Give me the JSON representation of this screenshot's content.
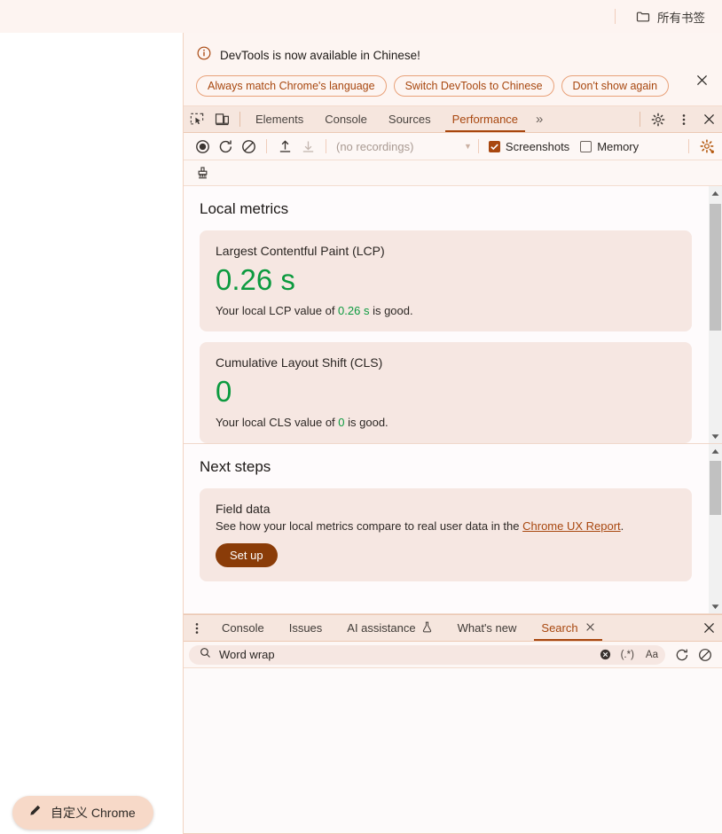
{
  "browser": {
    "bookmarks_button": {
      "label": "所有书签",
      "icon": "folder-icon"
    },
    "customize_chrome": {
      "label": "自定义 Chrome",
      "icon": "pencil-icon"
    }
  },
  "devtools": {
    "notification": {
      "icon": "info-icon",
      "title": "DevTools is now available in Chinese!",
      "buttons": [
        "Always match Chrome's language",
        "Switch DevTools to Chinese",
        "Don't show again"
      ],
      "close_icon": "close-icon"
    },
    "tabbar": {
      "left_icons": [
        "inspect-element-icon",
        "device-toolbar-icon"
      ],
      "tabs": [
        {
          "label": "Elements",
          "active": false
        },
        {
          "label": "Console",
          "active": false
        },
        {
          "label": "Sources",
          "active": false
        },
        {
          "label": "Performance",
          "active": true
        }
      ],
      "more_tabs": "»",
      "right_icons": [
        "gear-icon",
        "kebab-menu-icon",
        "close-icon"
      ]
    },
    "toolbar": {
      "record_icon": "record-icon",
      "reload_record_icon": "reload-and-record-icon",
      "clear_icon": "clear-icon",
      "upload_icon": "upload-profile-icon",
      "download_icon": "download-profile-icon",
      "recordings_placeholder": "(no recordings)",
      "recordings_caret": "▼",
      "screenshots": {
        "label": "Screenshots",
        "checked": true
      },
      "memory": {
        "label": "Memory",
        "checked": false
      },
      "capture_settings_icon": "capture-settings-gear-icon",
      "collect_garbage_icon": "collect-garbage-icon"
    },
    "local_metrics": {
      "title": "Local metrics",
      "cards": [
        {
          "label": "Largest Contentful Paint (LCP)",
          "value": "0.26 s",
          "desc_before": "Your local LCP value of ",
          "desc_value": "0.26 s",
          "desc_after": " is good.",
          "status_color": "#0c9a3f"
        },
        {
          "label": "Cumulative Layout Shift (CLS)",
          "value": "0",
          "desc_before": "Your local CLS value of ",
          "desc_value": "0",
          "desc_after": " is good.",
          "status_color": "#0c9a3f"
        }
      ]
    },
    "next_steps": {
      "title": "Next steps",
      "card": {
        "label": "Field data",
        "desc_before": "See how your local metrics compare to real user data in the ",
        "link": "Chrome UX Report",
        "desc_after": ".",
        "button": "Set up"
      }
    },
    "drawer": {
      "menu_icon": "kebab-menu-icon",
      "tabs": [
        {
          "label": "Console",
          "active": false,
          "closable": false
        },
        {
          "label": "Issues",
          "active": false,
          "closable": false
        },
        {
          "label": "AI assistance",
          "active": false,
          "closable": false,
          "icon": "flask-icon"
        },
        {
          "label": "What's new",
          "active": false,
          "closable": false
        },
        {
          "label": "Search",
          "active": true,
          "closable": true
        }
      ],
      "close_icon": "close-icon",
      "search": {
        "icon": "search-icon",
        "value": "Word wrap",
        "clear_icon": "clear-input-icon",
        "regex_label": "(.*)",
        "match_case_label": "Aa",
        "refresh_icon": "refresh-icon",
        "clear-results_icon": "clear-results-icon"
      }
    }
  },
  "colors": {
    "accent": "#a8470f",
    "good": "#0c9a3f",
    "card_bg": "#f6e7e2",
    "tabbar_bg": "#f6e6de",
    "button_primary": "#8a3c08"
  }
}
